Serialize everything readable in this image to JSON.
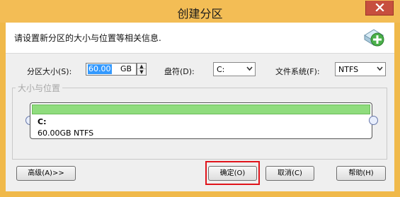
{
  "window": {
    "title": "创建分区"
  },
  "header": {
    "text": "请设置新分区的大小与位置等相关信息.",
    "icon": "add-disk-icon"
  },
  "size_field": {
    "label": "分区大小(S):",
    "value": "60.00",
    "unit": "GB"
  },
  "drive_field": {
    "label": "盘符(D):",
    "value": "C:"
  },
  "fs_field": {
    "label": "文件系统(F):",
    "value": "NTFS"
  },
  "group": {
    "title": "大小与位置"
  },
  "partition": {
    "drive": "C:",
    "info": "60.00GB NTFS",
    "fill_fraction": 1.0
  },
  "buttons": {
    "advanced": "高级(A)>>",
    "ok": "确定(O)",
    "cancel": "取消(C)",
    "help": "帮助(H)"
  },
  "colors": {
    "titlebar": "#f3bd55",
    "close": "#c74f3e",
    "partition_fill": "#8fdc7d",
    "highlight": "#e0141b"
  }
}
